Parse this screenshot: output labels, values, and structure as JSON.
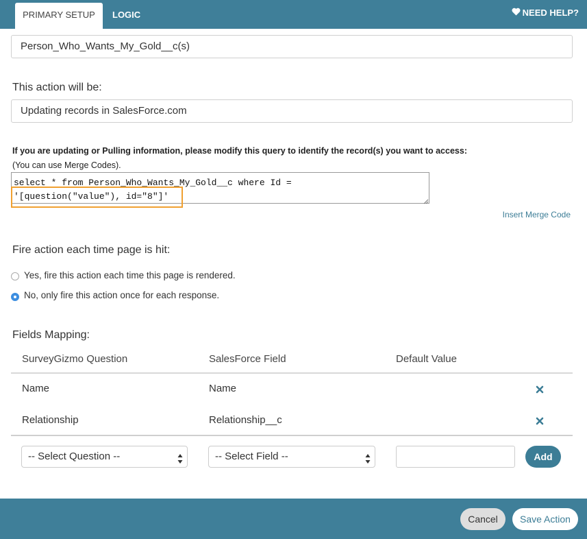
{
  "tabs": {
    "primary_setup": "PRIMARY SETUP",
    "logic": "LOGIC"
  },
  "help": {
    "label": "NEED HELP?",
    "icon": "heart-icon"
  },
  "object_field": {
    "value": "Person_Who_Wants_My_Gold__c(s)"
  },
  "action": {
    "label": "This action will be:",
    "value": "Updating records in SalesForce.com"
  },
  "query": {
    "instructions": "If you are updating or Pulling information, please modify this query to identify the record(s) you want to access:",
    "hint": "(You can use Merge Codes).",
    "line1": "select * from Person_Who_Wants_My_Gold__c where Id =",
    "line2": "'[question(\"value\"), id=\"8\"]'",
    "insert_link": "Insert Merge Code"
  },
  "fire": {
    "label": "Fire action each time page is hit:",
    "options": [
      {
        "label": "Yes, fire this action each time this page is rendered.",
        "checked": false
      },
      {
        "label": "No, only fire this action once for each response.",
        "checked": true
      }
    ]
  },
  "mapping": {
    "label": "Fields Mapping:",
    "columns": [
      "SurveyGizmo Question",
      "SalesForce Field",
      "Default Value"
    ],
    "rows": [
      {
        "question": "Name",
        "field": "Name"
      },
      {
        "question": "Relationship",
        "field": "Relationship__c"
      }
    ],
    "select_question": "-- Select Question --",
    "select_field": "-- Select Field --",
    "add_label": "Add"
  },
  "footer": {
    "cancel": "Cancel",
    "save": "Save Action"
  },
  "colors": {
    "bar": "#3f7f99",
    "accent": "#3c7d96",
    "highlight": "#f0a030",
    "radio_checked": "#3d8ee0"
  }
}
